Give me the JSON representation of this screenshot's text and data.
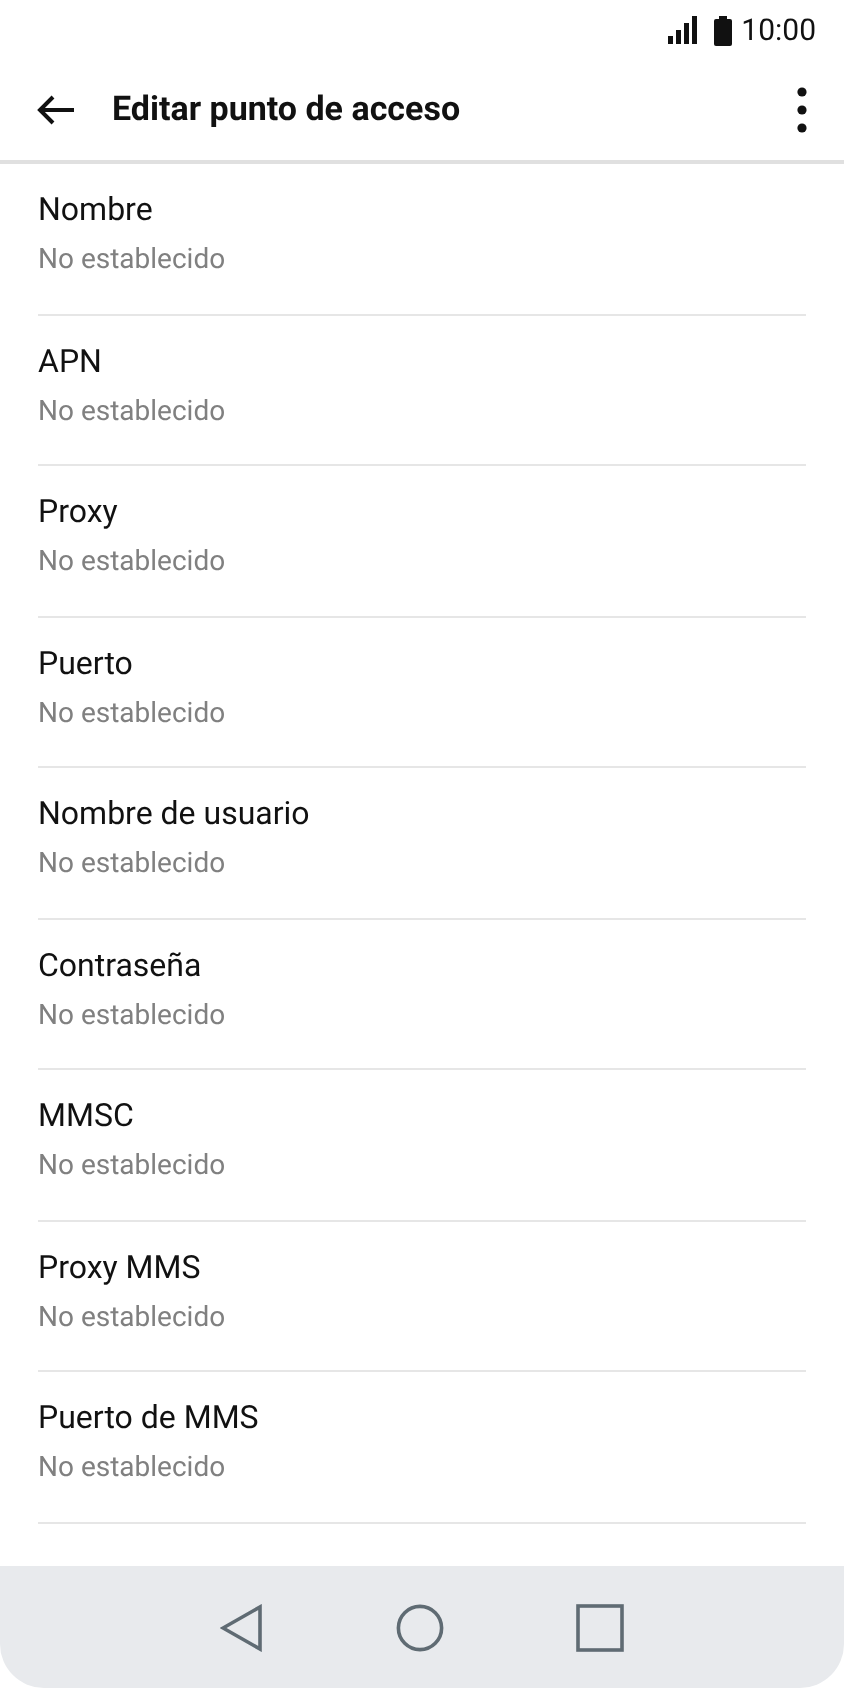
{
  "status_bar": {
    "time": "10:00"
  },
  "header": {
    "title": "Editar punto de acceso"
  },
  "settings": [
    {
      "label": "Nombre",
      "value": "No establecido"
    },
    {
      "label": "APN",
      "value": "No establecido"
    },
    {
      "label": "Proxy",
      "value": "No establecido"
    },
    {
      "label": "Puerto",
      "value": "No establecido"
    },
    {
      "label": "Nombre de usuario",
      "value": "No establecido"
    },
    {
      "label": "Contraseña",
      "value": "No establecido"
    },
    {
      "label": "MMSC",
      "value": "No establecido"
    },
    {
      "label": "Proxy MMS",
      "value": "No establecido"
    },
    {
      "label": "Puerto de MMS",
      "value": "No establecido"
    }
  ]
}
